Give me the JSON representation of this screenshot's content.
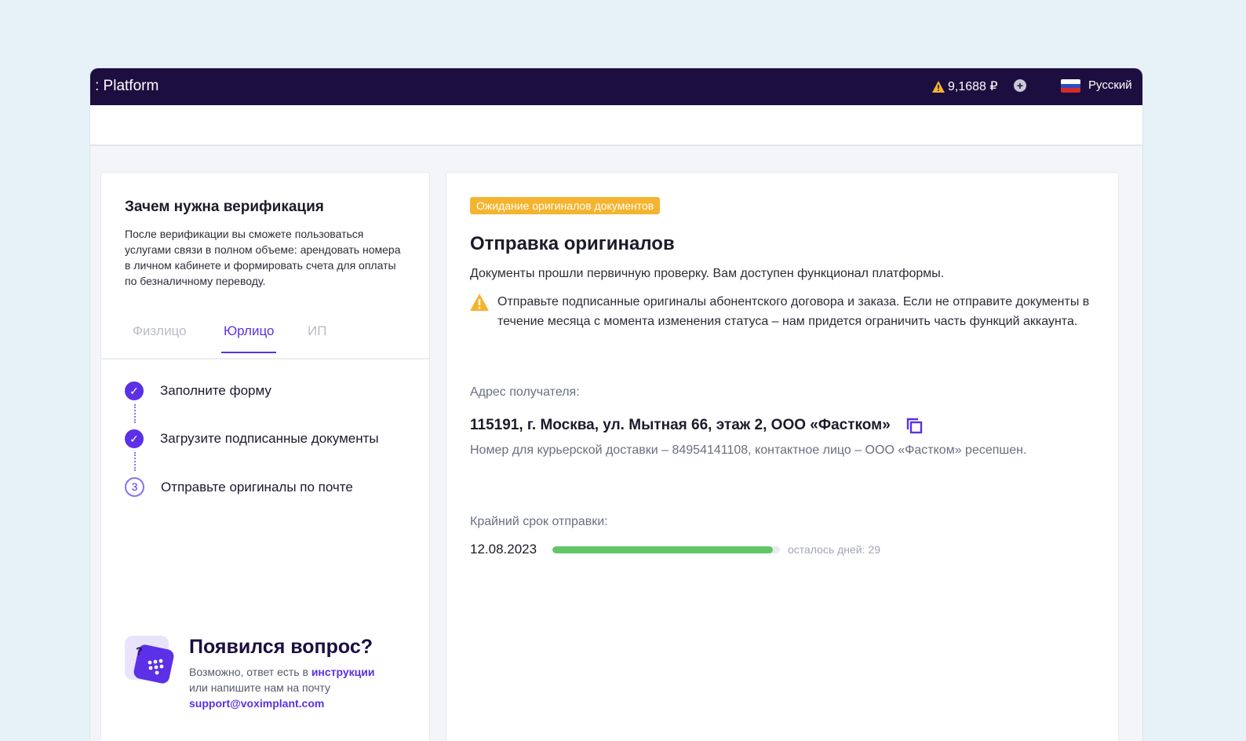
{
  "topbar": {
    "brand": ": Platform",
    "balance": "9,1688 ₽",
    "language": "Русский"
  },
  "left": {
    "why_title": "Зачем нужна верификация",
    "why_text": "После верификации вы сможете пользоваться услугами связи в полном объеме: арендовать номера в личном кабинете и формировать счета для оплаты по безналичному переводу.",
    "tabs": [
      {
        "label": "Физлицо",
        "active": false
      },
      {
        "label": "Юрлицо",
        "active": true
      },
      {
        "label": "ИП",
        "active": false
      }
    ],
    "steps": [
      {
        "label": "Заполните форму",
        "state": "done"
      },
      {
        "label": "Загрузите подписанные документы",
        "state": "done"
      },
      {
        "label": "Отправьте оригиналы по почте",
        "state": "current",
        "number": "3"
      }
    ],
    "question": {
      "title": "Появился вопрос?",
      "text_before": "Возможно, ответ есть в ",
      "link_instructions": "инструкции",
      "text_mid": "или напишите нам на почту",
      "email": "support@voximplant.com"
    }
  },
  "right": {
    "badge": "Ожидание оригиналов документов",
    "title": "Отправка оригиналов",
    "subtitle": "Документы прошли первичную проверку. Вам доступен функционал платформы.",
    "warning": "Отправьте подписанные оригиналы абонентского договора и заказа. Если не отправите документы в течение месяца с момента изменения статуса – нам придется ограничить часть функций аккаунта.",
    "address_label": "Адрес получателя:",
    "address": "115191, г. Москва, ул. Мытная 66, этаж 2, ООО «Фастком»",
    "address_note": "Номер для курьерской доставки – 84954141108, контактное лицо – ООО «Фастком» ресепшен.",
    "deadline_label": "Крайний срок отправки:",
    "deadline_date": "12.08.2023",
    "deadline_progress": 0.97,
    "days_left": "осталось дней: 29"
  },
  "colors": {
    "topbar": "#1c0e3f",
    "accent": "#5b30e6",
    "badge": "#f4b42f",
    "progress": "#62c668"
  }
}
